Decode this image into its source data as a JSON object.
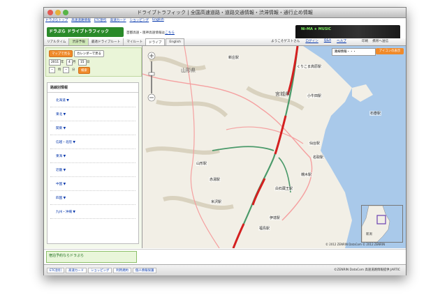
{
  "window": {
    "title": "ドライブトラフィック | 全国高速道路・道路交通情報・渋滞情報・通行止め情報"
  },
  "toplinks": [
    "ドラぷらトップ",
    "高速道路情報",
    "ETC割引",
    "高速カード",
    "ショッピング",
    "English"
  ],
  "header": {
    "logo_text": "ドラぷら ドライブトラフィック",
    "notice": "首都高速・阪神高速情報は",
    "notice_link": "こちら",
    "banner_text": "Ni-MA ★ MUSIC"
  },
  "tabs": [
    "リアルタイム",
    "渋滞予報",
    "最適ドライブルート",
    "マイルート"
  ],
  "map_tabs": [
    "ドライブ",
    "English"
  ],
  "userbar": {
    "greeting": "ようこそゲストさん",
    "login": "ログイン",
    "qa": "Q&A",
    "help": "ヘルプ"
  },
  "rightlinks": [
    "印刷",
    "携帯へ送信"
  ],
  "datebox": {
    "btn_map": "マップで見る",
    "btn_calendar": "カレンダーで見る",
    "year": "2011",
    "year_unit": "年",
    "month": "4",
    "month_unit": "月",
    "day": "15",
    "day_unit": "日",
    "hour": "--",
    "hour_unit": "時",
    "minute": "--",
    "minute_unit": "分",
    "btn_go": "検索"
  },
  "nav": {
    "heading": "路線別情報",
    "items": [
      "北海道 ▼",
      "東北 ▼",
      "関東 ▼",
      "信越・北陸 ▼",
      "東海 ▼",
      "近畿 ▼",
      "中国 ▼",
      "四国 ▼",
      "九州・沖縄 ▼"
    ]
  },
  "map": {
    "route_info": "路線情報・・・",
    "orange_button": "アイコンの表示",
    "prefectures": [
      "山形県",
      "宮城県"
    ],
    "cities": [
      "新庄駅",
      "くりこま高原駅",
      "小牛田駅",
      "石巻駅",
      "仙台駅",
      "名取駅",
      "山形駅",
      "赤湯駅",
      "米沢駅",
      "白石蔵王駅",
      "槻木駅",
      "福島駅",
      "伊達駅"
    ],
    "copyright": "© 2012 ZENRIN DataCom  © 2012 ZENRIN",
    "minimap_label": "新潟"
  },
  "ad": {
    "text": "宿泊予約ならドラぷら"
  },
  "footer": {
    "links": [
      "ETC割引",
      "高速カード",
      "ショッピング",
      "利用規約",
      "個人情報保護"
    ],
    "copyright": "©ZENRIN DataCom  高速道路情報提供 JARTIC"
  },
  "colors": {
    "accent_green": "#2a8a2a",
    "orange": "#f08a2a",
    "congestion_red": "#d42020",
    "sea": "#a9c9ea"
  }
}
